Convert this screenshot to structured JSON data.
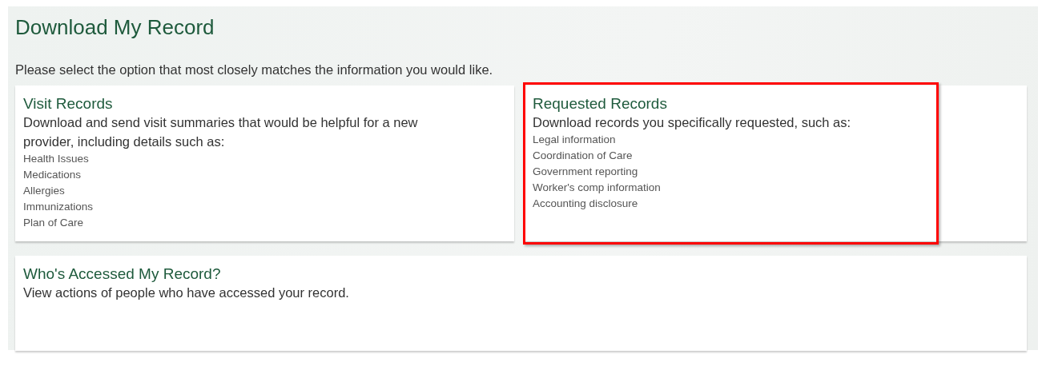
{
  "page": {
    "title": "Download My Record",
    "instruction": "Please select the option that most closely matches the information you would like."
  },
  "options": [
    {
      "title": "Visit Records",
      "description": "Download and send visit summaries that would be helpful for a new provider, including details such as:",
      "items": [
        "Health Issues",
        "Medications",
        "Allergies",
        "Immunizations",
        "Plan of Care"
      ],
      "highlighted": false
    },
    {
      "title": "Requested Records",
      "description": "Download records you specifically requested, such as:",
      "items": [
        "Legal information",
        "Coordination of Care",
        "Government reporting",
        "Worker's comp information",
        "Accounting disclosure"
      ],
      "highlighted": true
    },
    {
      "title": "Who's Accessed My Record?",
      "description": "View actions of people who have accessed your record.",
      "highlighted": false
    }
  ]
}
